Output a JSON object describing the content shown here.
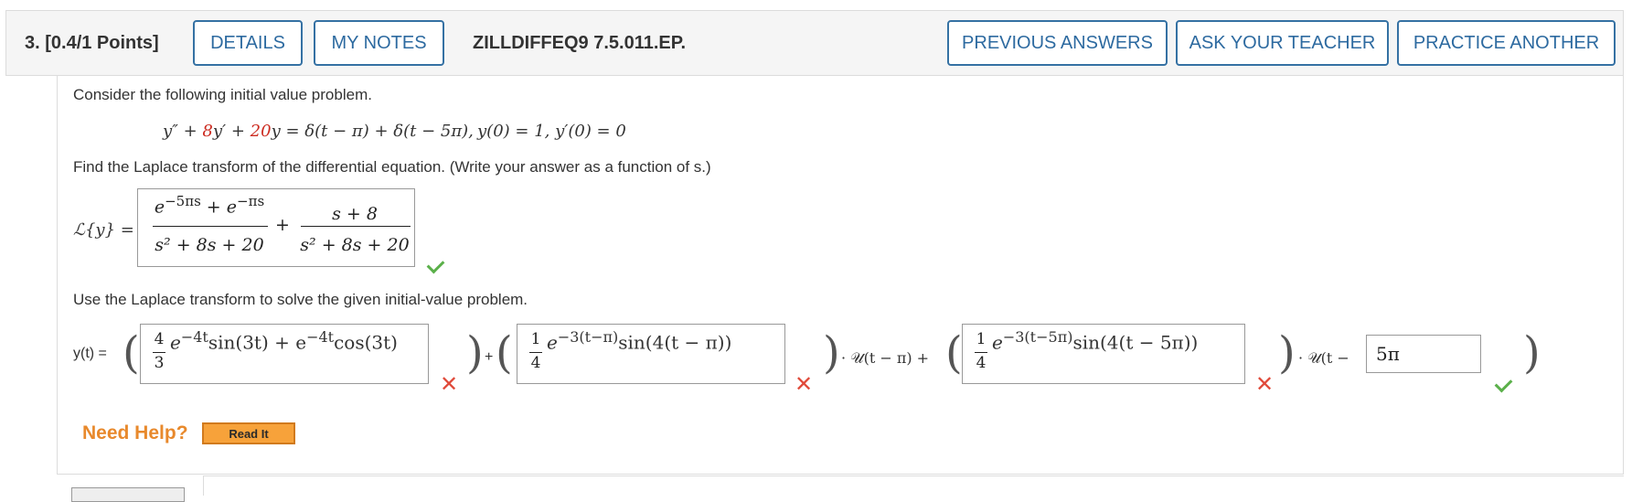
{
  "header": {
    "question_number": "3. [0.4/1 Points]",
    "details_label": "DETAILS",
    "my_notes_label": "MY NOTES",
    "question_code": "ZILLDIFFEQ9 7.5.011.EP.",
    "previous_answers_label": "PREVIOUS ANSWERS",
    "ask_teacher_label": "ASK YOUR TEACHER",
    "practice_another_label": "PRACTICE ANOTHER"
  },
  "problem": {
    "intro": "Consider the following initial value problem.",
    "ode_part1": "y″ + ",
    "ode_coef1": "8",
    "ode_part2": "y′ + ",
    "ode_coef2": "20",
    "ode_part3": "y = δ(t − π) + δ(t − 5π),",
    "ode_ic": "y(0) = 1,  y′(0) = 0",
    "laplace_prompt": "Find the Laplace transform of the differential equation. (Write your answer as a function of s.)",
    "laplace_label": "ℒ{y} =",
    "solve_prompt": "Use the Laplace transform to solve the given initial-value problem.",
    "y_label": "y(t) ="
  },
  "laplace_answer": {
    "num1": "e⁻⁵ᵖˢ + e⁻ᵖˢ",
    "num1_a": "−5πs",
    "num1_b": "−πs",
    "den1": "s² + 8s + 20",
    "plus": "+",
    "num2": "s + 8",
    "den2": "s² + 8s + 20",
    "status": "correct"
  },
  "solution": {
    "term1_a": "4",
    "term1_b": "3",
    "term1_exp": "−4t",
    "term1_sin": "sin(3t) + e",
    "term1_exp2": "−4t",
    "term1_cos": "cos(3t)",
    "term1_status": "incorrect",
    "term2_a": "1",
    "term2_b": "4",
    "term2_exp": "−3(t−π)",
    "term2_sin": "sin(4(t − π))",
    "term2_status": "incorrect",
    "step1": "· 𝒰(t − π) +",
    "term3_a": "1",
    "term3_b": "4",
    "term3_exp": "−3(t−5π)",
    "term3_sin": "sin(4(t − 5π))",
    "term3_status": "incorrect",
    "step2": "· 𝒰(t −",
    "shift_value": "5π",
    "shift_status": "correct"
  },
  "help": {
    "need_help": "Need Help?",
    "read_it": "Read It"
  },
  "colors": {
    "accent": "#3571a3",
    "error": "#e04a3a",
    "success": "#5bb04a",
    "help": "#e8892c"
  }
}
